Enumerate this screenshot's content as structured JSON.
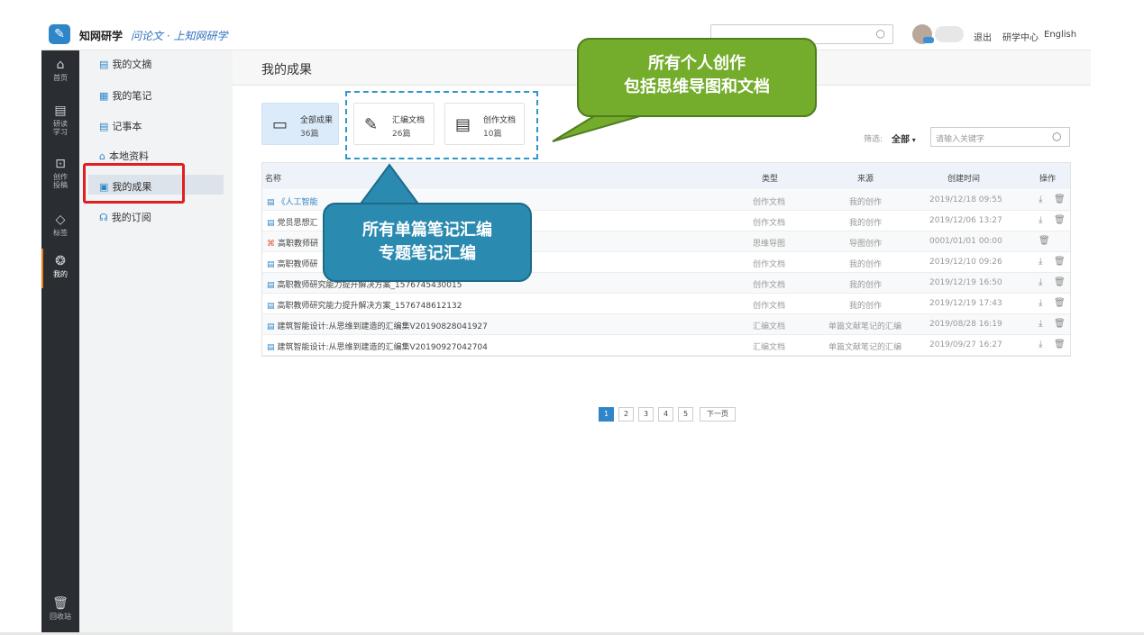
{
  "header": {
    "brand": "知网研学",
    "slogan": "问论文 · 上知网研学",
    "search_icon": "search-icon",
    "logout": "退出",
    "research_center": "研学中心",
    "english": "English"
  },
  "leftnav": [
    {
      "label": "首页",
      "icon": "home-icon"
    },
    {
      "label": "研读学习",
      "icon": "document-icon"
    },
    {
      "label": "创作投稿",
      "icon": "edit-icon"
    },
    {
      "label": "标签",
      "icon": "tag-icon"
    },
    {
      "label": "我的",
      "icon": "cube-icon"
    },
    {
      "label": "回收站",
      "icon": "trash-icon"
    }
  ],
  "sidemenu": [
    {
      "label": "我的文摘"
    },
    {
      "label": "我的笔记"
    },
    {
      "label": "记事本"
    },
    {
      "label": "本地资料"
    },
    {
      "label": "我的成果"
    },
    {
      "label": "我的订阅"
    }
  ],
  "main": {
    "title": "我的成果",
    "cards": [
      {
        "label": "全部成果",
        "count": "36篇"
      },
      {
        "label": "汇编文档",
        "count": "26篇"
      },
      {
        "label": "创作文档",
        "count": "10篇"
      }
    ],
    "filter_label": "筛选:",
    "filter_value": "全部",
    "keyword_placeholder": "请输入关键字"
  },
  "table": {
    "headers": [
      "名称",
      "类型",
      "来源",
      "创建时间",
      "操作"
    ],
    "rows": [
      {
        "name": "《人工智能",
        "type": "创作文档",
        "source": "我的创作",
        "time": "2019/12/18 09:55"
      },
      {
        "name": "党员思想汇",
        "type": "创作文档",
        "source": "我的创作",
        "time": "2019/12/06 13:27"
      },
      {
        "name": "高职教师研",
        "type": "思维导图",
        "source": "导图创作",
        "time": "0001/01/01 00:00"
      },
      {
        "name": "高职教师研",
        "type": "创作文档",
        "source": "我的创作",
        "time": "2019/12/10 09:26"
      },
      {
        "name": "高职教师研究能力提升解决方案_1576745430015",
        "type": "创作文档",
        "source": "我的创作",
        "time": "2019/12/19 16:50"
      },
      {
        "name": "高职教师研究能力提升解决方案_1576748612132",
        "type": "创作文档",
        "source": "我的创作",
        "time": "2019/12/19 17:43"
      },
      {
        "name": "建筑智能设计:从思维到建造的汇编集V20190828041927",
        "type": "汇编文档",
        "source": "单篇文献笔记的汇编",
        "time": "2019/08/28 16:19"
      },
      {
        "name": "建筑智能设计:从思维到建造的汇编集V20190927042704",
        "type": "汇编文档",
        "source": "单篇文献笔记的汇编",
        "time": "2019/09/27 16:27"
      }
    ]
  },
  "pagination": {
    "pages": [
      "1",
      "2",
      "3",
      "4",
      "5"
    ],
    "next": "下一页",
    "current": "1"
  },
  "callouts": {
    "green_line1": "所有个人创作",
    "green_line2": "包括思维导图和文档",
    "blue_line1": "所有单篇笔记汇编",
    "blue_line2": "专题笔记汇编"
  },
  "colors": {
    "accent": "#2e86c8",
    "highlight_red": "#e02020",
    "callout_green": "#74ac2c",
    "callout_blue": "#2a8ab0",
    "nav_dark": "#2a2e33"
  }
}
